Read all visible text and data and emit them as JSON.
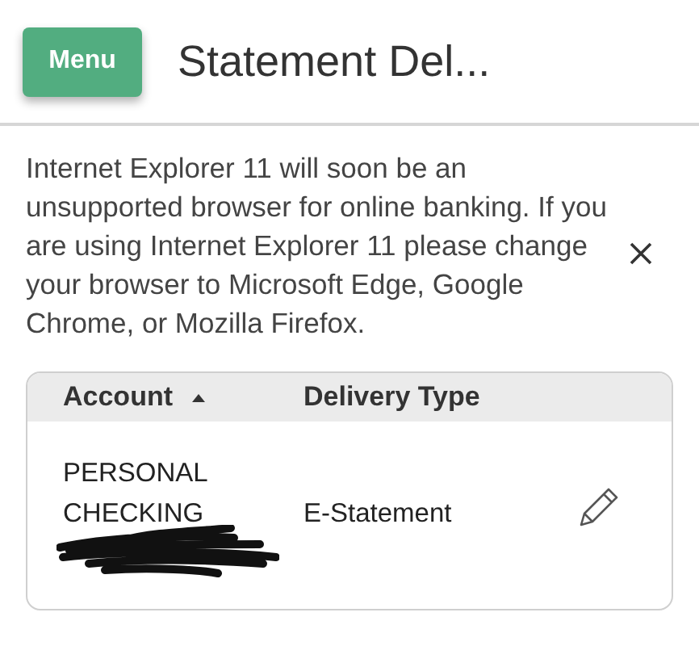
{
  "header": {
    "menu_button": "Menu",
    "title": "Statement Del..."
  },
  "notice": {
    "text": "Internet Explorer 11 will soon be an unsupported browser for online banking. If you are using Internet Explorer 11 please change your browser to Microsoft Edge, Google Chrome, or Mozilla Firefox."
  },
  "table": {
    "columns": [
      {
        "label": "Account",
        "sorted": true
      },
      {
        "label": "Delivery Type",
        "sorted": false
      }
    ],
    "rows": [
      {
        "account": "PERSONAL CHECKING",
        "delivery_type": "E-Statement"
      }
    ]
  }
}
